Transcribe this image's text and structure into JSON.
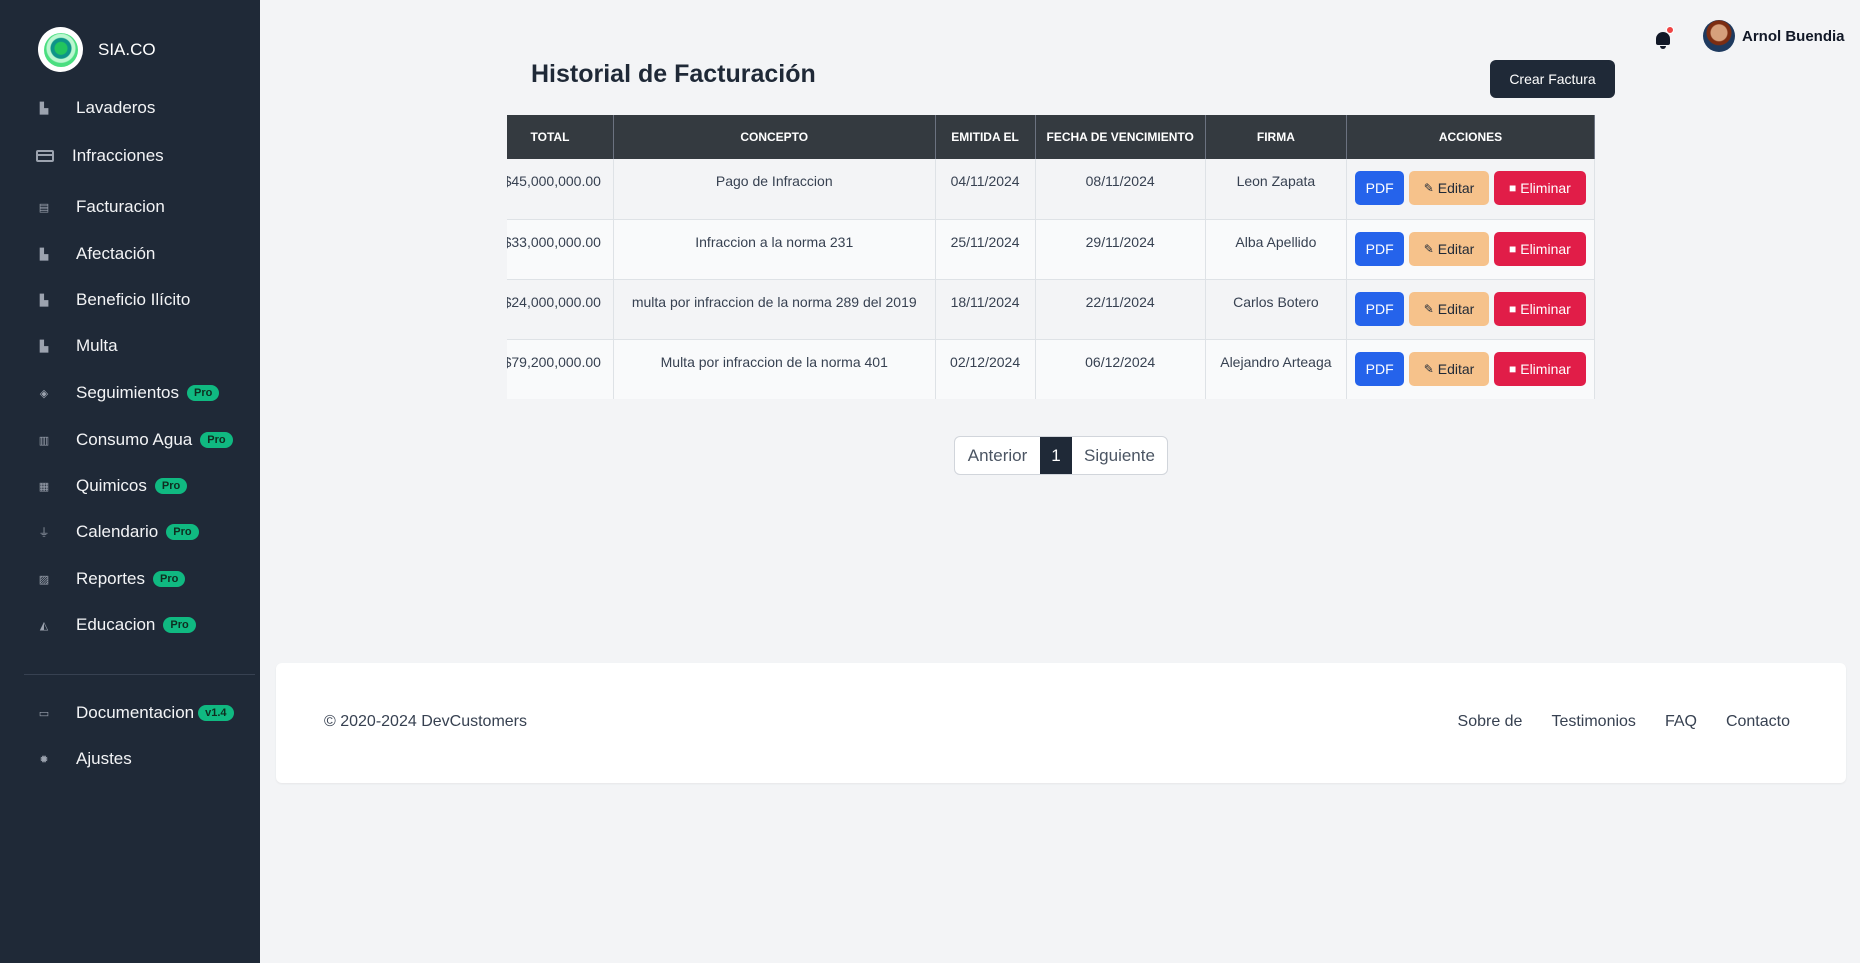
{
  "brand": {
    "name": "SIA.CO"
  },
  "sidebar": {
    "items": [
      {
        "label": "Lavaderos",
        "icon": "building-icon",
        "badge": ""
      },
      {
        "label": "Infracciones",
        "icon": "credit-card-icon",
        "badge": ""
      },
      {
        "label": "Facturacion",
        "icon": "document-icon",
        "badge": ""
      },
      {
        "label": "Afectación",
        "icon": "building-icon",
        "badge": ""
      },
      {
        "label": "Beneficio Ilícito",
        "icon": "building-icon",
        "badge": ""
      },
      {
        "label": "Multa",
        "icon": "building-icon",
        "badge": ""
      },
      {
        "label": "Seguimientos",
        "icon": "layers-icon",
        "badge": "Pro"
      },
      {
        "label": "Consumo Agua",
        "icon": "map-icon",
        "badge": "Pro"
      },
      {
        "label": "Quimicos",
        "icon": "calendar-icon",
        "badge": "Pro"
      },
      {
        "label": "Calendario",
        "icon": "flask-icon",
        "badge": "Pro"
      },
      {
        "label": "Reportes",
        "icon": "chart-icon",
        "badge": "Pro"
      },
      {
        "label": "Educacion",
        "icon": "graduation-cap-icon",
        "badge": "Pro"
      }
    ],
    "bottom": [
      {
        "label": "Documentacion",
        "icon": "inbox-icon",
        "badge": "v1.4"
      },
      {
        "label": "Ajustes",
        "icon": "gear-icon",
        "badge": ""
      }
    ]
  },
  "topbar": {
    "user_name": "Arnol Buendia",
    "notification_icon": "bell-icon"
  },
  "main": {
    "title": "Historial de Facturación",
    "create_button": "Crear Factura",
    "table": {
      "headers": [
        "TOTAL",
        "CONCEPTO",
        "EMITIDA EL",
        "FECHA DE VENCIMIENTO",
        "FIRMA",
        "ACCIONES"
      ],
      "rows": [
        {
          "total": "$45,000,000.00",
          "concepto": "Pago de Infraccion",
          "emitida": "04/11/2024",
          "vencimiento": "08/11/2024",
          "firma": "Leon Zapata"
        },
        {
          "total": "$33,000,000.00",
          "concepto": "Infraccion a la norma 231",
          "emitida": "25/11/2024",
          "vencimiento": "29/11/2024",
          "firma": "Alba Apellido"
        },
        {
          "total": "$24,000,000.00",
          "concepto": "multa por infraccion de la norma 289 del 2019",
          "emitida": "18/11/2024",
          "vencimiento": "22/11/2024",
          "firma": "Carlos Botero"
        },
        {
          "total": "$79,200,000.00",
          "concepto": "Multa por infraccion de la norma 401",
          "emitida": "02/12/2024",
          "vencimiento": "06/12/2024",
          "firma": "Alejandro Arteaga"
        }
      ],
      "actions": {
        "pdf": "PDF",
        "edit": "Editar",
        "delete": "Eliminar"
      }
    },
    "pagination": {
      "prev": "Anterior",
      "current": "1",
      "next": "Siguiente"
    }
  },
  "footer": {
    "copyright": "© 2020-2024 DevCustomers",
    "links": [
      "Sobre de",
      "Testimonios",
      "FAQ",
      "Contacto"
    ]
  },
  "colors": {
    "sidebar_bg": "#1f2937",
    "pro_badge": "#10b981",
    "pdf": "#2563eb",
    "edit": "#f6c28b",
    "delete": "#e11d48"
  }
}
